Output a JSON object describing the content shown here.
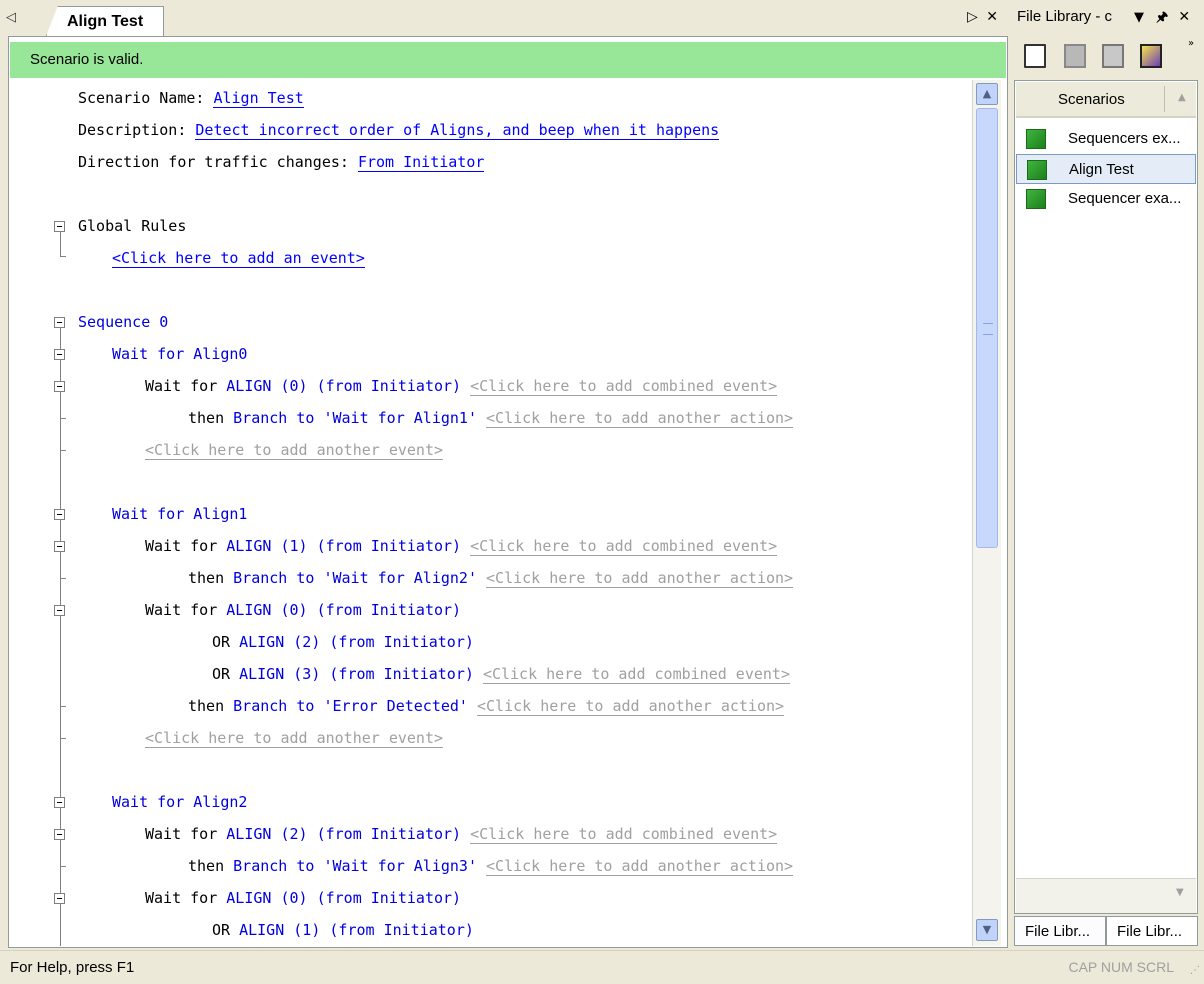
{
  "document_tab": {
    "title": "Align Test"
  },
  "status_banner": "Scenario is valid.",
  "header_fields": [
    {
      "label": "Scenario Name: ",
      "value": "Align Test"
    },
    {
      "label": "Description: ",
      "value": "Detect incorrect order of Aligns, and beep when it happens"
    },
    {
      "label": "Direction for traffic changes: ",
      "value": "From Initiator"
    }
  ],
  "editor": {
    "global_rules": "Global Rules",
    "add_event_link": "<Click here to add an event>",
    "sequence_0": "Sequence 0",
    "state_align0": "Wait for Align0",
    "state_align1": "Wait for Align1",
    "state_align2": "Wait for Align2",
    "wait_for": "Wait for ",
    "then": "then ",
    "or": "OR ",
    "align0_init": "ALIGN (0) (from Initiator)",
    "align1_init": "ALIGN (1) (from Initiator)",
    "align2_init": "ALIGN (2) (from Initiator)",
    "align3_init": "ALIGN (3) (from Initiator)",
    "branch_align1": "Branch to 'Wait for Align1'",
    "branch_align2": "Branch to 'Wait for Align2'",
    "branch_align3": "Branch to 'Wait for Align3'",
    "branch_error": "Branch to 'Error Detected'",
    "add_combined_event": "<Click here to add combined event>",
    "add_another_action": "<Click here to add another action>",
    "add_another_event": "<Click here to add another event>"
  },
  "file_library": {
    "title": "File Library - c",
    "column_header": "Scenarios",
    "items": [
      {
        "label": "Sequencers ex..."
      },
      {
        "label": "Align Test"
      },
      {
        "label": "Sequencer exa..."
      }
    ],
    "bottom_tabs": [
      "File Libr...",
      "File Libr..."
    ]
  },
  "status_bar": {
    "help_text": "For Help, press F1",
    "indicators": "CAP  NUM  SCRL"
  }
}
